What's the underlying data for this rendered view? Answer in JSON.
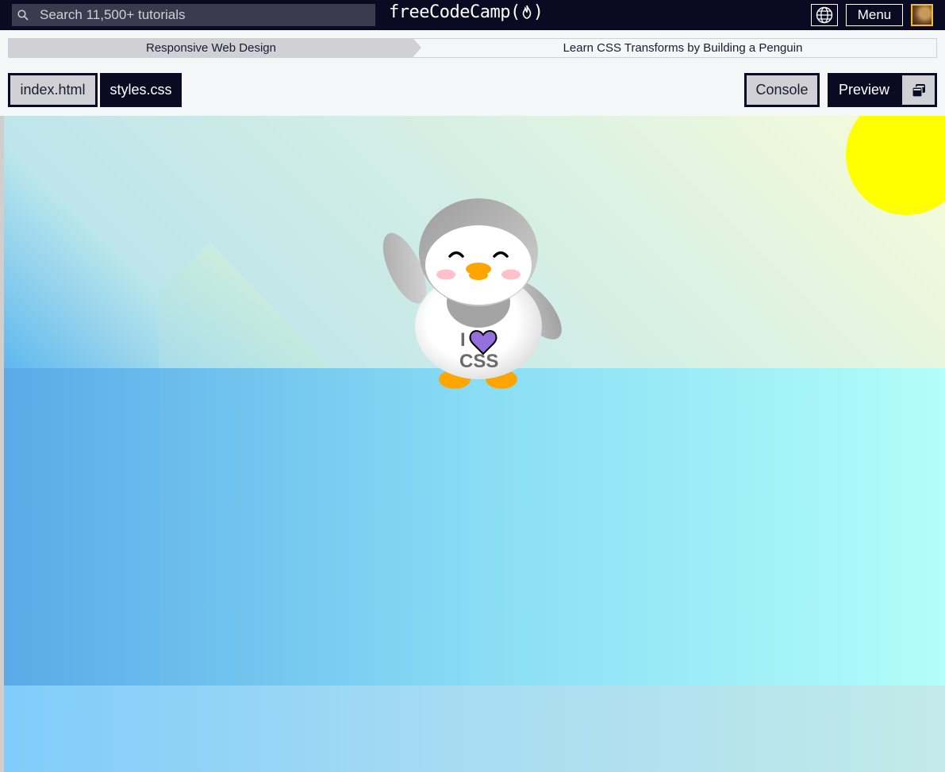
{
  "topnav": {
    "search_placeholder": "Search 11,500+ tutorials",
    "logo_text": "freeCodeCamp",
    "logo_icon": "flame-icon",
    "language_icon": "globe-icon",
    "menu_label": "Menu",
    "avatar_icon": "user-avatar"
  },
  "breadcrumb": {
    "superblock": "Responsive Web Design",
    "lesson": "Learn CSS Transforms by Building a Penguin"
  },
  "tabs": {
    "index": "index.html",
    "styles": "styles.css",
    "console": "Console",
    "preview": "Preview",
    "popout_icon": "popout-window-icon"
  },
  "preview": {
    "shirt_line1": "I",
    "shirt_line2": "CSS",
    "heart_icon": "heart-icon",
    "colors": {
      "sun": "#ffff00",
      "beak_and_feet": "#ffa500",
      "heart": "#9370db",
      "cheeks": "#ffc0cb"
    }
  }
}
